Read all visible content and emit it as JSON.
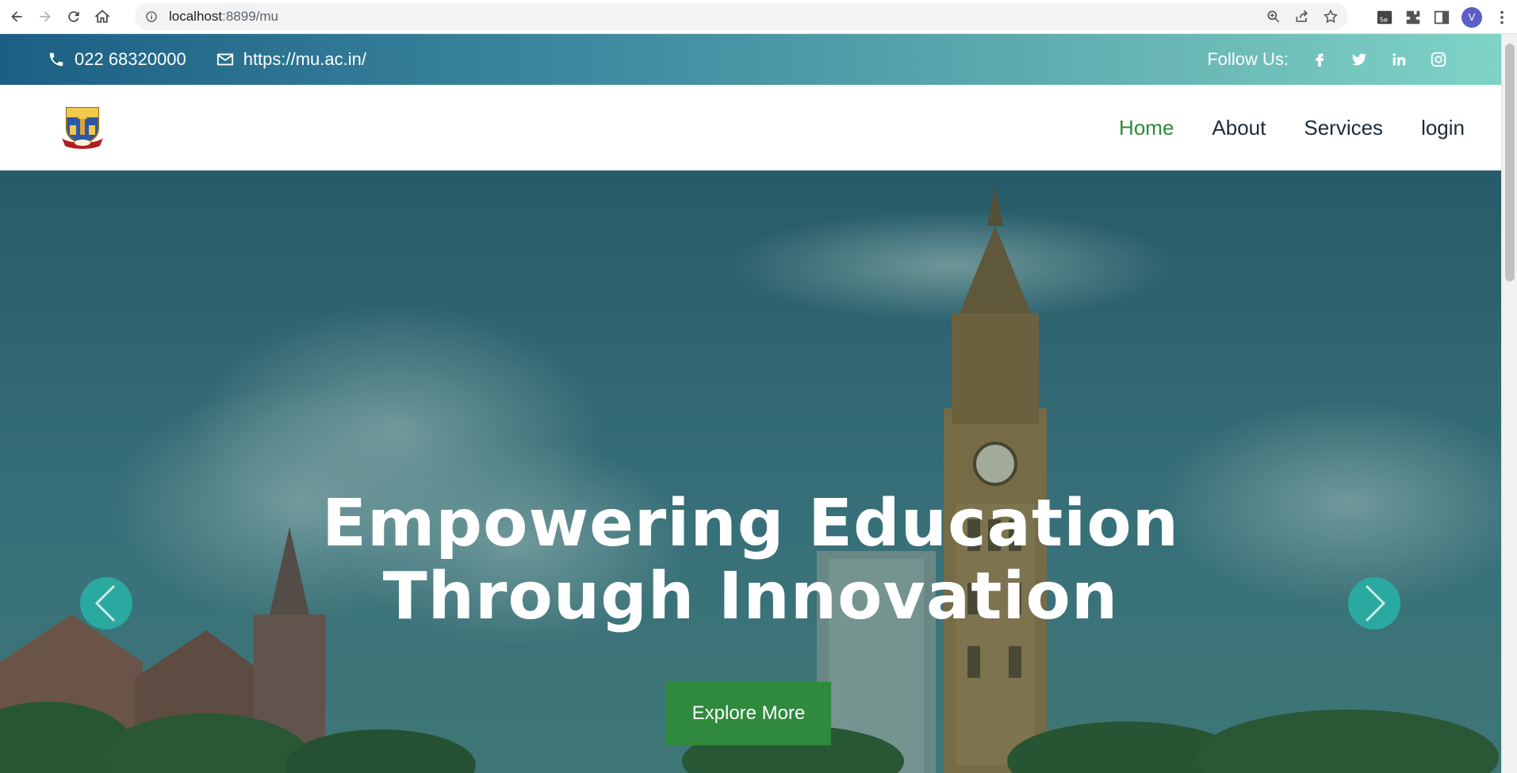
{
  "browser": {
    "url_host": "localhost",
    "url_path": ":8899/mu",
    "avatar_letter": "V"
  },
  "topbar": {
    "phone": "022 68320000",
    "website": "https://mu.ac.in/",
    "follow_label": "Follow Us:",
    "social": [
      "facebook-icon",
      "twitter-icon",
      "linkedin-icon",
      "instagram-icon"
    ]
  },
  "nav": {
    "items": [
      {
        "label": "Home",
        "active": true
      },
      {
        "label": "About",
        "active": false
      },
      {
        "label": "Services",
        "active": false
      },
      {
        "label": "login",
        "active": false
      }
    ]
  },
  "hero": {
    "title_line1": "Empowering Education",
    "title_line2": "Through Innovation",
    "cta": "Explore More"
  },
  "colors": {
    "accent_green": "#2e8b3a",
    "arrow_teal": "#2aa9a0",
    "topbar_start": "#1c5f84",
    "topbar_end": "#7ed3c6"
  }
}
